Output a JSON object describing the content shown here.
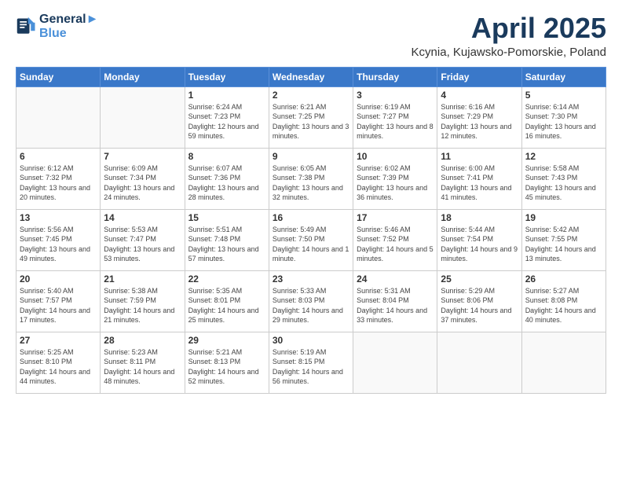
{
  "header": {
    "logo_line1": "General",
    "logo_line2": "Blue",
    "title": "April 2025",
    "subtitle": "Kcynia, Kujawsko-Pomorskie, Poland"
  },
  "weekdays": [
    "Sunday",
    "Monday",
    "Tuesday",
    "Wednesday",
    "Thursday",
    "Friday",
    "Saturday"
  ],
  "weeks": [
    [
      {
        "day": "",
        "sunrise": "",
        "sunset": "",
        "daylight": ""
      },
      {
        "day": "",
        "sunrise": "",
        "sunset": "",
        "daylight": ""
      },
      {
        "day": "1",
        "sunrise": "Sunrise: 6:24 AM",
        "sunset": "Sunset: 7:23 PM",
        "daylight": "Daylight: 12 hours and 59 minutes."
      },
      {
        "day": "2",
        "sunrise": "Sunrise: 6:21 AM",
        "sunset": "Sunset: 7:25 PM",
        "daylight": "Daylight: 13 hours and 3 minutes."
      },
      {
        "day": "3",
        "sunrise": "Sunrise: 6:19 AM",
        "sunset": "Sunset: 7:27 PM",
        "daylight": "Daylight: 13 hours and 8 minutes."
      },
      {
        "day": "4",
        "sunrise": "Sunrise: 6:16 AM",
        "sunset": "Sunset: 7:29 PM",
        "daylight": "Daylight: 13 hours and 12 minutes."
      },
      {
        "day": "5",
        "sunrise": "Sunrise: 6:14 AM",
        "sunset": "Sunset: 7:30 PM",
        "daylight": "Daylight: 13 hours and 16 minutes."
      }
    ],
    [
      {
        "day": "6",
        "sunrise": "Sunrise: 6:12 AM",
        "sunset": "Sunset: 7:32 PM",
        "daylight": "Daylight: 13 hours and 20 minutes."
      },
      {
        "day": "7",
        "sunrise": "Sunrise: 6:09 AM",
        "sunset": "Sunset: 7:34 PM",
        "daylight": "Daylight: 13 hours and 24 minutes."
      },
      {
        "day": "8",
        "sunrise": "Sunrise: 6:07 AM",
        "sunset": "Sunset: 7:36 PM",
        "daylight": "Daylight: 13 hours and 28 minutes."
      },
      {
        "day": "9",
        "sunrise": "Sunrise: 6:05 AM",
        "sunset": "Sunset: 7:38 PM",
        "daylight": "Daylight: 13 hours and 32 minutes."
      },
      {
        "day": "10",
        "sunrise": "Sunrise: 6:02 AM",
        "sunset": "Sunset: 7:39 PM",
        "daylight": "Daylight: 13 hours and 36 minutes."
      },
      {
        "day": "11",
        "sunrise": "Sunrise: 6:00 AM",
        "sunset": "Sunset: 7:41 PM",
        "daylight": "Daylight: 13 hours and 41 minutes."
      },
      {
        "day": "12",
        "sunrise": "Sunrise: 5:58 AM",
        "sunset": "Sunset: 7:43 PM",
        "daylight": "Daylight: 13 hours and 45 minutes."
      }
    ],
    [
      {
        "day": "13",
        "sunrise": "Sunrise: 5:56 AM",
        "sunset": "Sunset: 7:45 PM",
        "daylight": "Daylight: 13 hours and 49 minutes."
      },
      {
        "day": "14",
        "sunrise": "Sunrise: 5:53 AM",
        "sunset": "Sunset: 7:47 PM",
        "daylight": "Daylight: 13 hours and 53 minutes."
      },
      {
        "day": "15",
        "sunrise": "Sunrise: 5:51 AM",
        "sunset": "Sunset: 7:48 PM",
        "daylight": "Daylight: 13 hours and 57 minutes."
      },
      {
        "day": "16",
        "sunrise": "Sunrise: 5:49 AM",
        "sunset": "Sunset: 7:50 PM",
        "daylight": "Daylight: 14 hours and 1 minute."
      },
      {
        "day": "17",
        "sunrise": "Sunrise: 5:46 AM",
        "sunset": "Sunset: 7:52 PM",
        "daylight": "Daylight: 14 hours and 5 minutes."
      },
      {
        "day": "18",
        "sunrise": "Sunrise: 5:44 AM",
        "sunset": "Sunset: 7:54 PM",
        "daylight": "Daylight: 14 hours and 9 minutes."
      },
      {
        "day": "19",
        "sunrise": "Sunrise: 5:42 AM",
        "sunset": "Sunset: 7:55 PM",
        "daylight": "Daylight: 14 hours and 13 minutes."
      }
    ],
    [
      {
        "day": "20",
        "sunrise": "Sunrise: 5:40 AM",
        "sunset": "Sunset: 7:57 PM",
        "daylight": "Daylight: 14 hours and 17 minutes."
      },
      {
        "day": "21",
        "sunrise": "Sunrise: 5:38 AM",
        "sunset": "Sunset: 7:59 PM",
        "daylight": "Daylight: 14 hours and 21 minutes."
      },
      {
        "day": "22",
        "sunrise": "Sunrise: 5:35 AM",
        "sunset": "Sunset: 8:01 PM",
        "daylight": "Daylight: 14 hours and 25 minutes."
      },
      {
        "day": "23",
        "sunrise": "Sunrise: 5:33 AM",
        "sunset": "Sunset: 8:03 PM",
        "daylight": "Daylight: 14 hours and 29 minutes."
      },
      {
        "day": "24",
        "sunrise": "Sunrise: 5:31 AM",
        "sunset": "Sunset: 8:04 PM",
        "daylight": "Daylight: 14 hours and 33 minutes."
      },
      {
        "day": "25",
        "sunrise": "Sunrise: 5:29 AM",
        "sunset": "Sunset: 8:06 PM",
        "daylight": "Daylight: 14 hours and 37 minutes."
      },
      {
        "day": "26",
        "sunrise": "Sunrise: 5:27 AM",
        "sunset": "Sunset: 8:08 PM",
        "daylight": "Daylight: 14 hours and 40 minutes."
      }
    ],
    [
      {
        "day": "27",
        "sunrise": "Sunrise: 5:25 AM",
        "sunset": "Sunset: 8:10 PM",
        "daylight": "Daylight: 14 hours and 44 minutes."
      },
      {
        "day": "28",
        "sunrise": "Sunrise: 5:23 AM",
        "sunset": "Sunset: 8:11 PM",
        "daylight": "Daylight: 14 hours and 48 minutes."
      },
      {
        "day": "29",
        "sunrise": "Sunrise: 5:21 AM",
        "sunset": "Sunset: 8:13 PM",
        "daylight": "Daylight: 14 hours and 52 minutes."
      },
      {
        "day": "30",
        "sunrise": "Sunrise: 5:19 AM",
        "sunset": "Sunset: 8:15 PM",
        "daylight": "Daylight: 14 hours and 56 minutes."
      },
      {
        "day": "",
        "sunrise": "",
        "sunset": "",
        "daylight": ""
      },
      {
        "day": "",
        "sunrise": "",
        "sunset": "",
        "daylight": ""
      },
      {
        "day": "",
        "sunrise": "",
        "sunset": "",
        "daylight": ""
      }
    ]
  ]
}
